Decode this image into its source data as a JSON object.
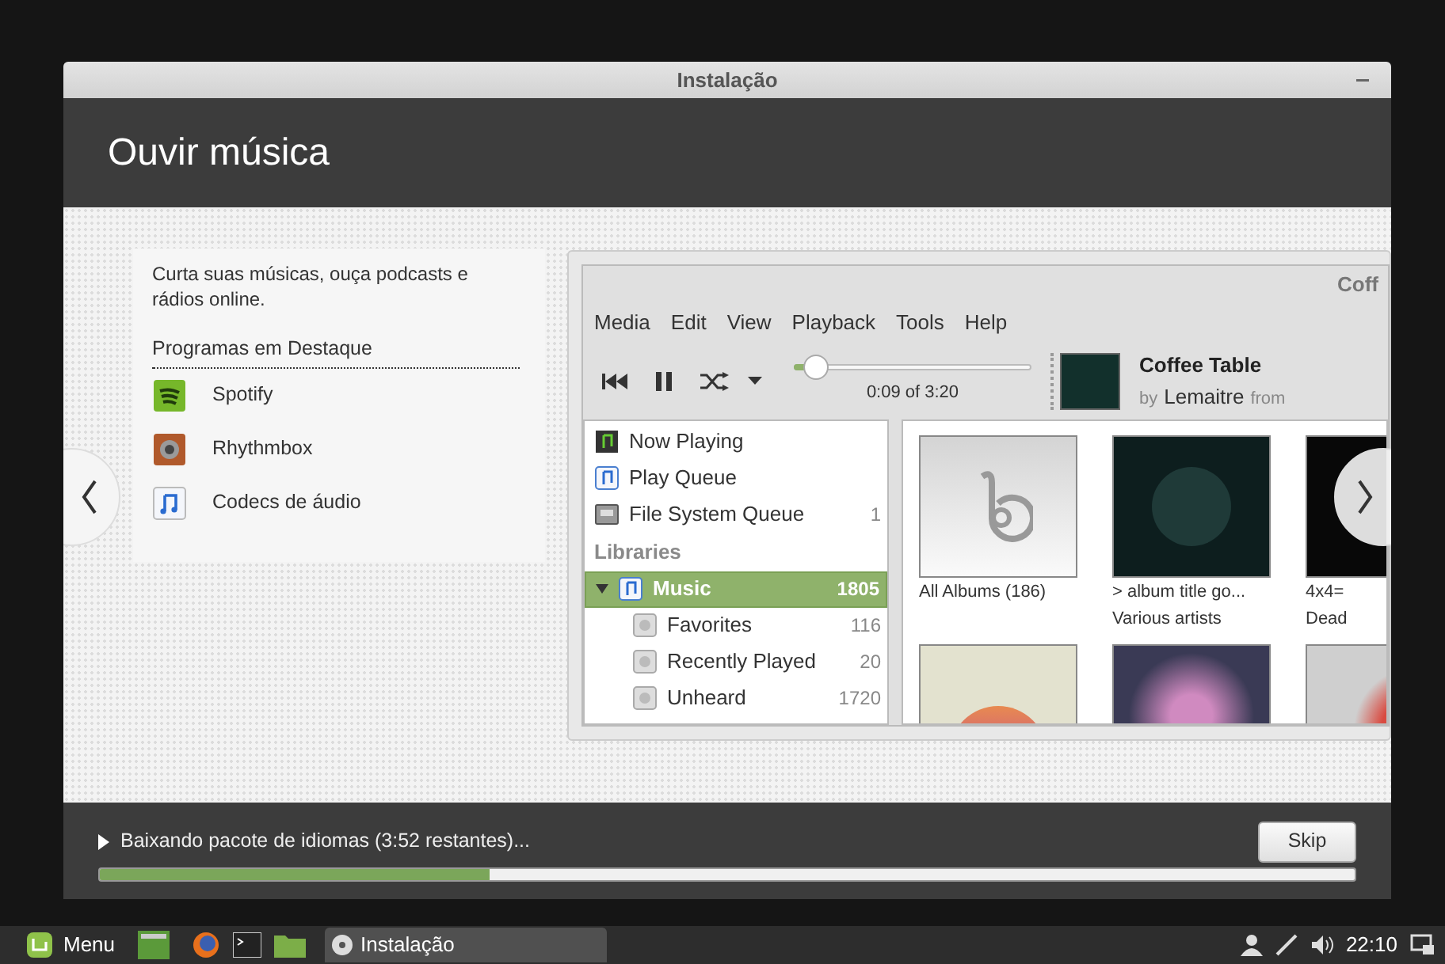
{
  "window": {
    "title": "Instalação"
  },
  "header": {
    "title": "Ouvir música"
  },
  "intro": {
    "text": "Curta suas músicas, ouça podcasts e rádios online.",
    "featured_heading": "Programas em Destaque",
    "apps": [
      {
        "name": "Spotify",
        "kind": "spotify"
      },
      {
        "name": "Rhythmbox",
        "kind": "rhythmbox"
      },
      {
        "name": "Codecs de áudio",
        "kind": "codecs"
      }
    ]
  },
  "screenshot": {
    "title": "Coff",
    "menu": [
      "Media",
      "Edit",
      "View",
      "Playback",
      "Tools",
      "Help"
    ],
    "time": "0:09 of 3:20",
    "level": 0.09,
    "track": {
      "title": "Coffee Table",
      "by": "by",
      "artist": "Lemaitre",
      "from": "from"
    },
    "sidebar": [
      {
        "kind": "now-playing",
        "label": "Now Playing",
        "selected": false
      },
      {
        "kind": "queue",
        "label": "Play Queue",
        "selected": false
      },
      {
        "kind": "fs-queue",
        "label": "File System Queue",
        "count": "1",
        "selected": false
      },
      {
        "kind": "heading",
        "label": "Libraries"
      },
      {
        "kind": "music",
        "label": "Music",
        "count": "1805",
        "selected": true,
        "expanded": true,
        "children": [
          {
            "kind": "playlist",
            "label": "Favorites",
            "count": "116",
            "selected": false
          },
          {
            "kind": "playlist",
            "label": "Recently Played",
            "count": "20",
            "selected": false
          },
          {
            "kind": "playlist",
            "label": "Unheard",
            "count": "1720",
            "selected": false
          }
        ]
      }
    ],
    "albums": [
      {
        "kind": "default",
        "title": "All Albums (186)"
      },
      {
        "kind": "dark",
        "title": "> album title go...",
        "artist": "Various artists"
      },
      {
        "kind": "black",
        "title": "4x4=",
        "artist": "Dead"
      },
      {
        "kind": "sunset"
      },
      {
        "kind": "pink"
      },
      {
        "kind": "red"
      }
    ]
  },
  "footer": {
    "status": "Baixando pacote de idiomas (3:52 restantes)...",
    "level": 0.31,
    "skip": "Skip"
  },
  "taskbar": {
    "menu": "Menu",
    "windows": [
      {
        "label": "Instalação",
        "selected": true
      }
    ],
    "clock": "22:10"
  }
}
